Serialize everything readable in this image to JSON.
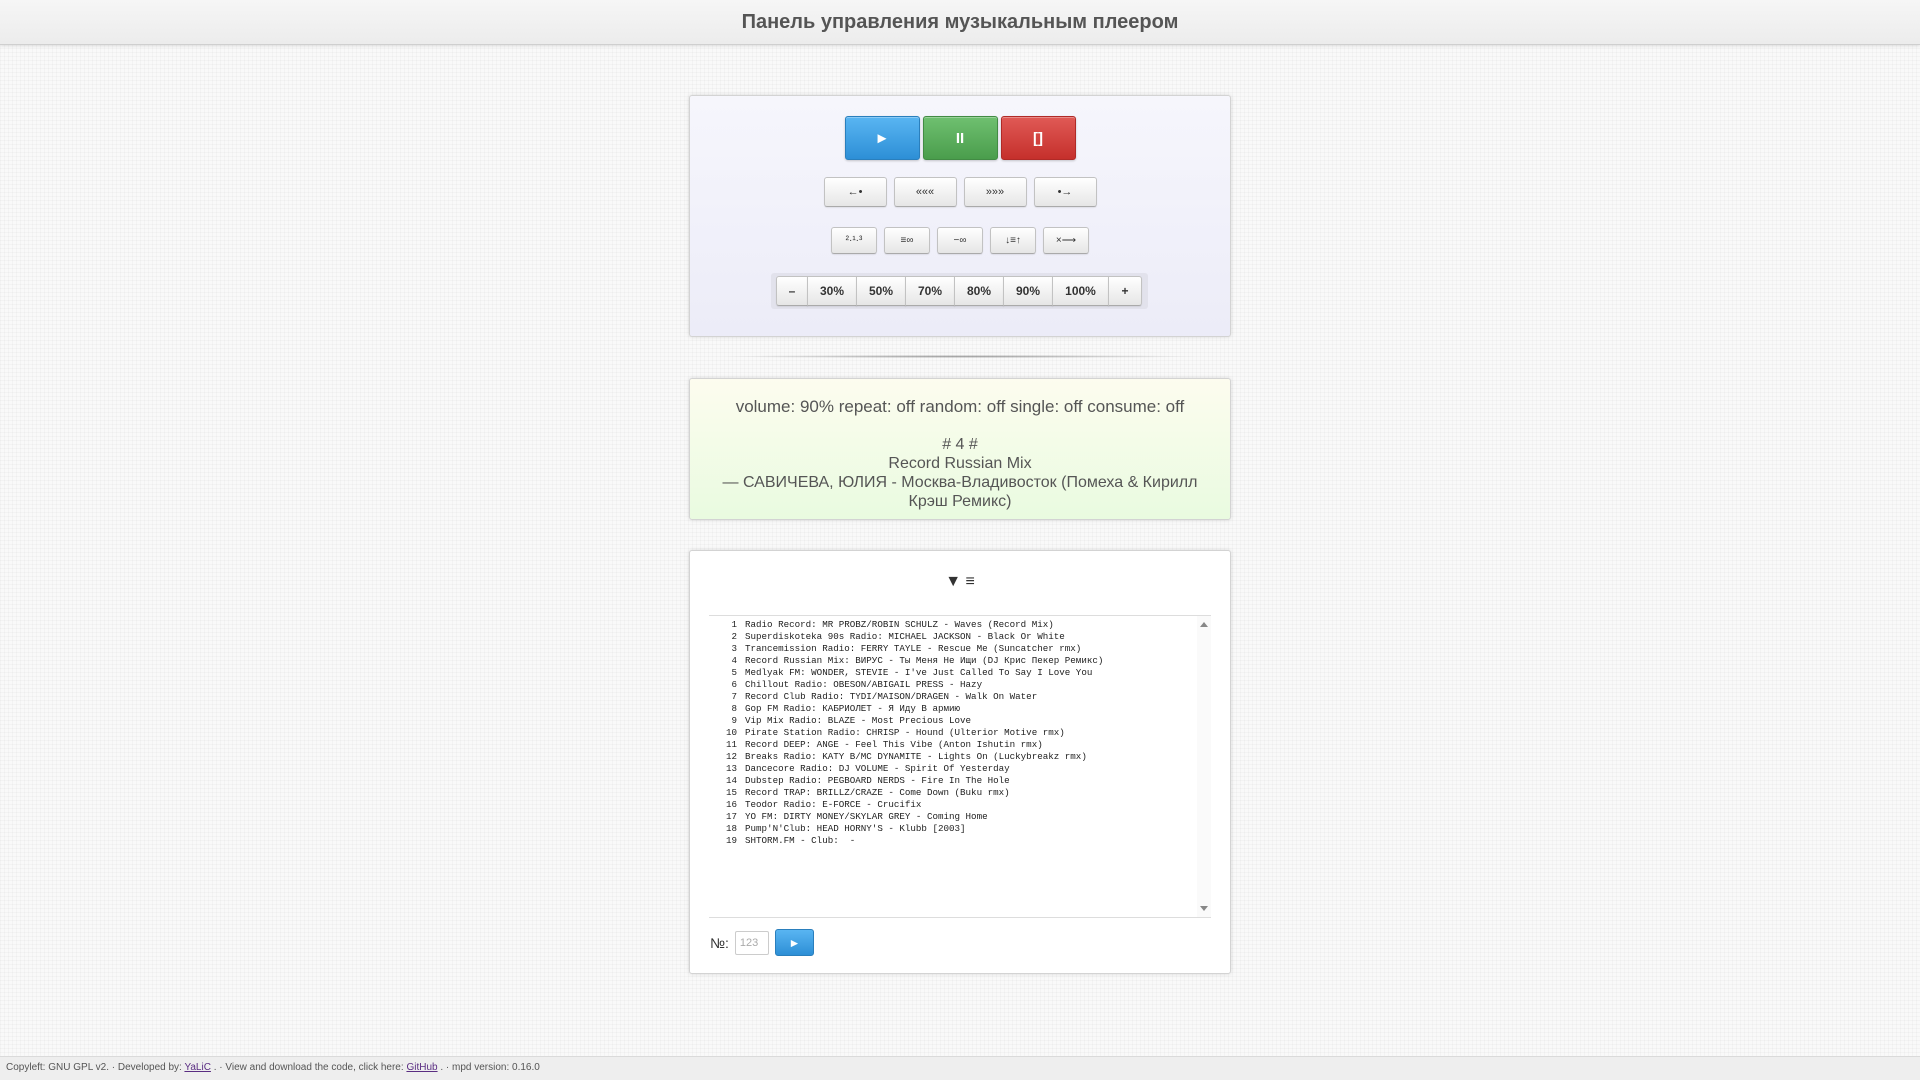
{
  "header": {
    "title": "Панель управления музыкальным плеером"
  },
  "controls": {
    "play": "►",
    "pause": "II",
    "stop": "[]",
    "prev": "←•",
    "seek_back": "«««",
    "seek_forward": "»»»",
    "next": "•→",
    "random": "²·¹·³",
    "repeat": "≡∞",
    "single": "−∞",
    "sort": "↓≡↑",
    "clear": "×⟶",
    "volume": {
      "minus": "–",
      "levels": [
        "30%",
        "50%",
        "70%",
        "80%",
        "90%",
        "100%"
      ],
      "plus": "+"
    }
  },
  "status": {
    "line": "volume: 90% repeat: off random: off single: off consume: off",
    "track_number": "# 4 #",
    "station": "Record Russian Mix",
    "song": "— САВИЧЕВА, ЮЛИЯ - Москва-Владивосток (Помеха & Кирилл Крэш Ремикс)"
  },
  "playlist": {
    "header": "▼ ≡",
    "items": [
      {
        "num": "1",
        "text": "Radio Record: MR PROBZ/ROBIN SCHULZ - Waves (Record Mix)"
      },
      {
        "num": "2",
        "text": "Superdiskoteka 90s Radio: MICHAEL JACKSON - Black Or White"
      },
      {
        "num": "3",
        "text": "Trancemission Radio: FERRY TAYLE - Rescue Me (Suncatcher rmx)"
      },
      {
        "num": "4",
        "text": "Record Russian Mix: ВИРУС - Ты Меня Не Ищи (DJ Крис Пекер Ремикс)"
      },
      {
        "num": "5",
        "text": "Medlyak FM: WONDER, STEVIE - I've Just Called To Say I Love You"
      },
      {
        "num": "6",
        "text": "Chillout Radio: OBESON/ABIGAIL PRESS - Hazy"
      },
      {
        "num": "7",
        "text": "Record Club Radio: TYDI/MAISON/DRAGEN - Walk On Water"
      },
      {
        "num": "8",
        "text": "Gop FM Radio: КАБРИОЛЕТ - Я Иду В армию"
      },
      {
        "num": "9",
        "text": "Vip Mix Radio: BLAZE - Most Precious Love"
      },
      {
        "num": "10",
        "text": "Pirate Station Radio: CHRISP - Hound (Ulterior Motive rmx)"
      },
      {
        "num": "11",
        "text": "Record DEEP: ANGE - Feel This Vibe (Anton Ishutin rmx)"
      },
      {
        "num": "12",
        "text": "Breaks Radio: KATY B/MC DYNAMITE - Lights On (Luckybreakz rmx)"
      },
      {
        "num": "13",
        "text": "Dancecore Radio: DJ VOLUME - Spirit Of Yesterday"
      },
      {
        "num": "14",
        "text": "Dubstep Radio: PEGBOARD NERDS - Fire In The Hole"
      },
      {
        "num": "15",
        "text": "Record TRAP: BRILLZ/CRAZE - Come Down (Buku rmx)"
      },
      {
        "num": "16",
        "text": "Teodor Radio: E-FORCE - Crucifix"
      },
      {
        "num": "17",
        "text": "YO FM: DIRTY MONEY/SKYLAR GREY - Coming Home"
      },
      {
        "num": "18",
        "text": "Pump'N'Club: HEAD HORNY'S - Klubb [2003]"
      },
      {
        "num": "19",
        "text": "SHTORM.FM - Club:  -"
      }
    ],
    "goto_label": "№:",
    "goto_placeholder": "123",
    "goto_button": "►"
  },
  "footer": {
    "copyleft": "Copyleft: GNU GPL v2.  ·  Developed by:",
    "developer": "YaLiC",
    "view_text": ".  ·  View and download the code, click here:",
    "github": "GitHub",
    "mpd_version": ".  ·  mpd version: 0.16.0"
  }
}
